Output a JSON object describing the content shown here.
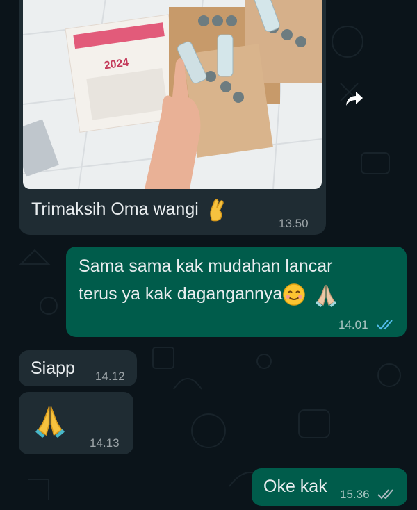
{
  "messages": [
    {
      "id": "m1",
      "direction": "in",
      "type": "image",
      "caption": "Trimaksih Oma wangi",
      "caption_emoji": "crossed-fingers-emoji",
      "time": "13.50"
    },
    {
      "id": "m2",
      "direction": "out",
      "lines": [
        "Sama sama kak mudahan lancar",
        "terus ya kak dagangannya"
      ],
      "emojis": [
        "smiling-face-emoji",
        "folded-hands-emoji"
      ],
      "time": "14.01",
      "status": "read"
    },
    {
      "id": "m3",
      "direction": "in",
      "text": "Siapp",
      "time": "14.12"
    },
    {
      "id": "m4",
      "direction": "in",
      "type": "emoji",
      "emoji": "folded-hands-emoji",
      "time": "14.13"
    },
    {
      "id": "m5",
      "direction": "out",
      "text": "Oke kak",
      "time": "15.36",
      "status": "delivered"
    }
  ],
  "photo": {
    "calendar_year": "2024"
  },
  "colors": {
    "background": "#0b141a",
    "incoming_bubble": "#1f2c33",
    "outgoing_bubble": "#005c4b",
    "read_tick": "#53bdeb",
    "delivered_tick": "#8696a0"
  }
}
